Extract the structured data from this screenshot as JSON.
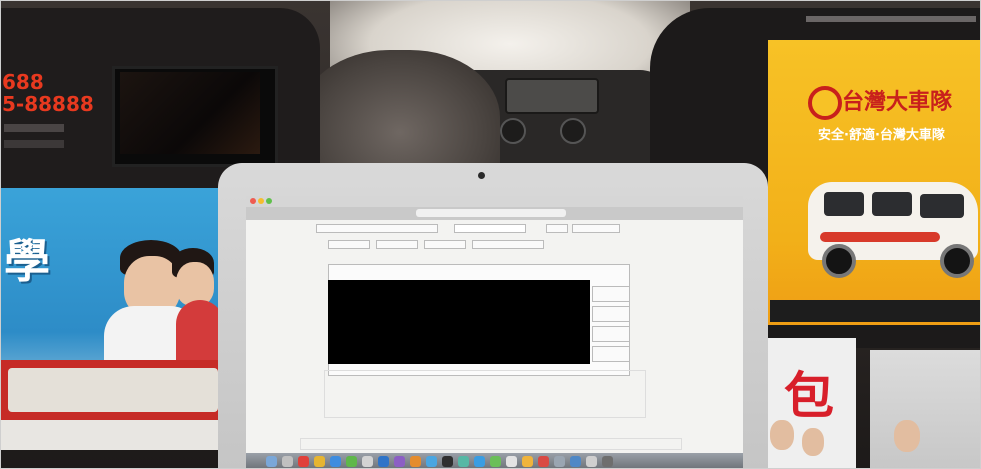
{
  "scene": {
    "description_free": true,
    "left_ad": {
      "phone_top": "688",
      "phone_main": "5-88888",
      "tagline": "",
      "big_char": "學"
    },
    "right_ad": {
      "brand": "台灣大車隊",
      "slogan": "安全·舒適·台灣大車隊"
    },
    "right_bottom": {
      "big_char": "包"
    },
    "colors": {
      "taxi_yellow": "#f7c226",
      "brand_red": "#c8201c",
      "poster_blue": "#3aa3d9"
    }
  }
}
